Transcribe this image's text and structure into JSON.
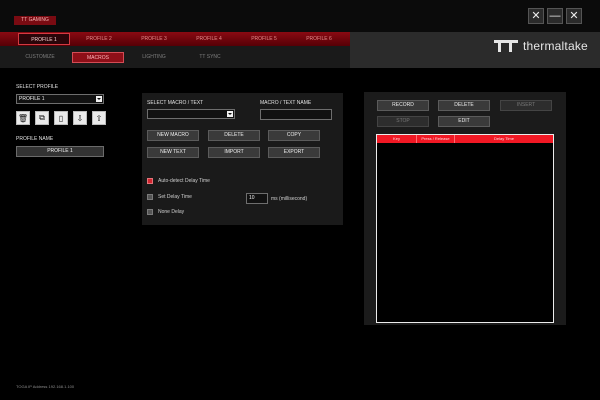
{
  "app": {
    "tag": "TT GAMING",
    "brand": "thermaltake"
  },
  "window_controls": {
    "tools_icon": "tools-icon",
    "minimize_icon": "minimize-icon",
    "close_icon": "close-icon"
  },
  "profile_tabs": [
    "PROFILE 1",
    "PROFILE 2",
    "PROFILE 3",
    "PROFILE 4",
    "PROFILE 5",
    "PROFILE 6"
  ],
  "active_profile_tab": 0,
  "sub_tabs": [
    "CUSTOMIZE",
    "MACROS",
    "LIGHTING",
    "TT SYNC"
  ],
  "active_sub_tab": 1,
  "left_panel": {
    "select_profile_label": "SELECT PROFILE",
    "selected_profile": "PROFILE 1",
    "profile_name_label": "PROFILE NAME",
    "profile_name_value": "PROFILE 1",
    "icons": [
      "delete-icon",
      "copy-icon",
      "paste-icon",
      "import-icon",
      "export-icon"
    ]
  },
  "macro_panel": {
    "select_label": "SELECT MACRO / TEXT",
    "name_label": "MACRO / TEXT NAME",
    "buttons": {
      "new_macro": "NEW MACRO",
      "delete": "DELETE",
      "copy": "COPY",
      "new_text": "NEW TEXT",
      "import": "IMPORT",
      "export": "EXPORT"
    },
    "options": {
      "auto_delay": "Auto-detect Delay Time",
      "set_delay": "Set Delay Time",
      "none_delay": "None Delay"
    },
    "delay_value": "10",
    "delay_unit": "ms (millisecond)"
  },
  "record_panel": {
    "buttons": {
      "record": "RECORD",
      "delete": "DELETE",
      "insert": "INSERT",
      "stop": "STOP",
      "edit": "EDIT"
    },
    "table_headers": [
      "Key",
      "Press / Release",
      "Delay Time"
    ]
  },
  "footer": {
    "ip": "TOGA IP Address 192.168.1.100"
  },
  "colors": {
    "accent": "#d32630",
    "header_red": "#8a0a12",
    "panel": "#1a1a1a"
  }
}
